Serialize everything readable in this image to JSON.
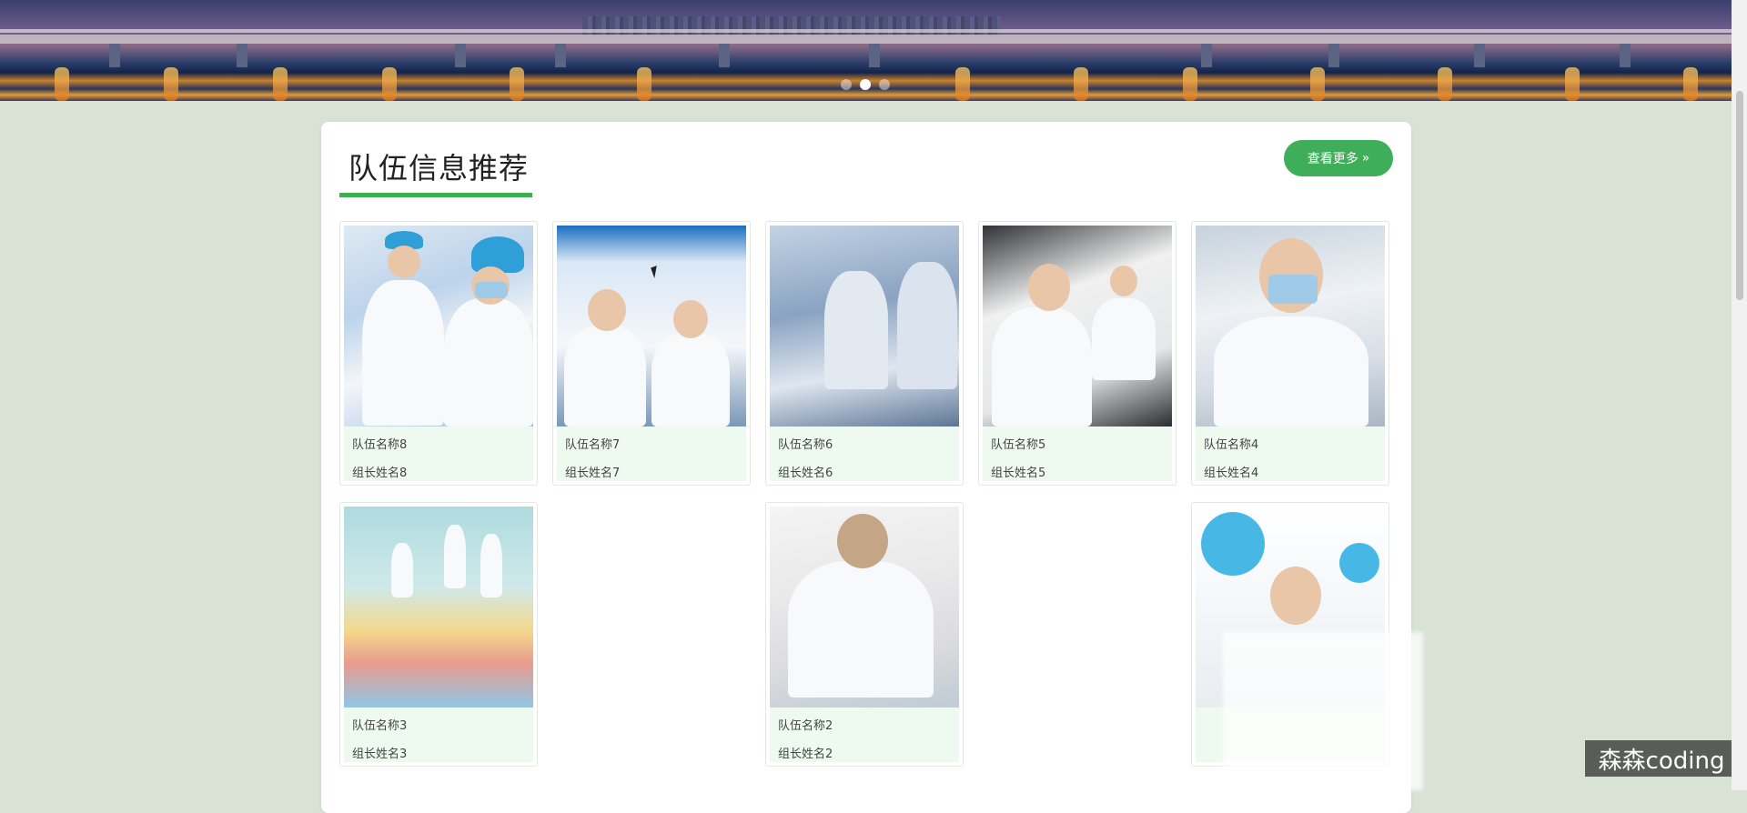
{
  "banner": {
    "carousel_dots": [
      {
        "active": false
      },
      {
        "active": true
      },
      {
        "active": false
      }
    ]
  },
  "section": {
    "title": "队伍信息推荐",
    "more_label": "查看更多",
    "more_icon": "double-chevron-right-icon"
  },
  "teams": [
    {
      "name": "队伍名称8",
      "leader": "组长姓名8"
    },
    {
      "name": "队伍名称7",
      "leader": "组长姓名7"
    },
    {
      "name": "队伍名称6",
      "leader": "组长姓名6"
    },
    {
      "name": "队伍名称5",
      "leader": "组长姓名5"
    },
    {
      "name": "队伍名称4",
      "leader": "组长姓名4"
    },
    {
      "name": "队伍名称3",
      "leader": "组长姓名3"
    },
    {
      "name": "队伍名称2",
      "leader": "组长姓名2"
    },
    {
      "name": "",
      "leader": ""
    }
  ],
  "watermark": "森森coding",
  "colors": {
    "accent": "#3fae5a",
    "page_bg": "#d8e2d5",
    "card_info_bg": "#eef9f0"
  }
}
